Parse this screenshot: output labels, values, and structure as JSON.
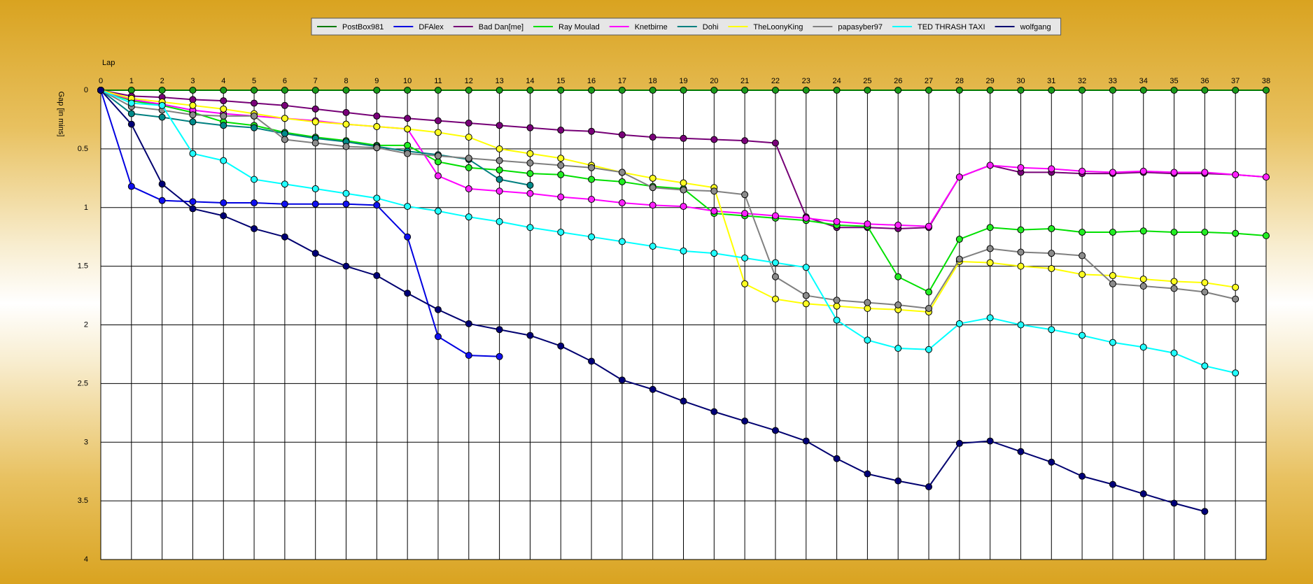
{
  "chart_data": {
    "type": "line",
    "xlabel": "Lap",
    "ylabel": "Gap [in mins]",
    "xlim": [
      0,
      38
    ],
    "ylim": [
      0,
      4
    ],
    "y_inverted": true,
    "x_ticks": [
      0,
      1,
      2,
      3,
      4,
      5,
      6,
      7,
      8,
      9,
      10,
      11,
      12,
      13,
      14,
      15,
      16,
      17,
      18,
      19,
      20,
      21,
      22,
      23,
      24,
      25,
      26,
      27,
      28,
      29,
      30,
      31,
      32,
      33,
      34,
      35,
      36,
      37,
      38
    ],
    "y_ticks": [
      "0",
      "0.5",
      "1",
      "1.5",
      "2",
      "2.5",
      "3",
      "3.5",
      "4"
    ],
    "grid": true,
    "legend_placement": "top-center",
    "series": [
      {
        "name": "PostBox981",
        "color": "#007a00",
        "marker_color": "#1a9a1a",
        "values": [
          0,
          0,
          0,
          0,
          0,
          0,
          0,
          0,
          0,
          0,
          0,
          0,
          0,
          0,
          0,
          0,
          0,
          0,
          0,
          0,
          0,
          0,
          0,
          0,
          0,
          0,
          0,
          0,
          0,
          0,
          0,
          0,
          0,
          0,
          0,
          0,
          0,
          0,
          0
        ]
      },
      {
        "name": "DFAlex",
        "color": "#0000e0",
        "marker_color": "#1010f0",
        "values": [
          0,
          0.82,
          0.94,
          0.95,
          0.96,
          0.96,
          0.97,
          0.97,
          0.97,
          0.98,
          1.25,
          2.1,
          2.26,
          2.27
        ]
      },
      {
        "name": "Bad Dan[me]",
        "color": "#760076",
        "marker_color": "#7a007a",
        "values": [
          0,
          0.05,
          0.06,
          0.08,
          0.09,
          0.11,
          0.13,
          0.16,
          0.19,
          0.22,
          0.24,
          0.26,
          0.28,
          0.3,
          0.32,
          0.34,
          0.35,
          0.38,
          0.4,
          0.41,
          0.42,
          0.43,
          0.45,
          1.08,
          1.17,
          1.17,
          1.18,
          1.17,
          0.74,
          0.64,
          0.7,
          0.7,
          0.71,
          0.71,
          0.7,
          0.71,
          0.71,
          0.72,
          0.74
        ]
      },
      {
        "name": "Ray Moulad",
        "color": "#00e000",
        "marker_color": "#22ee22",
        "values": [
          0,
          0.09,
          0.13,
          0.19,
          0.27,
          0.3,
          0.36,
          0.4,
          0.43,
          0.47,
          0.47,
          0.61,
          0.66,
          0.68,
          0.71,
          0.72,
          0.76,
          0.78,
          0.82,
          0.84,
          1.05,
          1.07,
          1.09,
          1.11,
          1.15,
          1.16,
          1.59,
          1.72,
          1.27,
          1.17,
          1.19,
          1.18,
          1.21,
          1.21,
          1.2,
          1.21,
          1.21,
          1.22,
          1.24
        ]
      },
      {
        "name": "Knetbirne",
        "color": "#ff00ff",
        "marker_color": "#ff22ff",
        "values": [
          0,
          0.08,
          0.12,
          0.17,
          0.2,
          0.22,
          0.24,
          0.26,
          0.29,
          0.31,
          0.33,
          0.73,
          0.84,
          0.86,
          0.88,
          0.91,
          0.93,
          0.96,
          0.98,
          0.99,
          1.03,
          1.05,
          1.07,
          1.09,
          1.12,
          1.14,
          1.15,
          1.16,
          0.74,
          0.64,
          0.66,
          0.67,
          0.69,
          0.7,
          0.69,
          0.7,
          0.7,
          0.72,
          0.74
        ]
      },
      {
        "name": "Dohi",
        "color": "#008080",
        "marker_color": "#008b8b",
        "values": [
          0,
          0.2,
          0.23,
          0.27,
          0.3,
          0.32,
          0.37,
          0.41,
          0.44,
          0.48,
          0.52,
          0.55,
          0.59,
          0.76,
          0.81
        ]
      },
      {
        "name": "TheLoonyKing",
        "color": "#ffff00",
        "marker_color": "#ffff22",
        "values": [
          0,
          0.07,
          0.1,
          0.13,
          0.16,
          0.2,
          0.24,
          0.27,
          0.29,
          0.31,
          0.33,
          0.36,
          0.4,
          0.5,
          0.54,
          0.58,
          0.64,
          0.7,
          0.75,
          0.79,
          0.83,
          1.65,
          1.78,
          1.82,
          1.84,
          1.86,
          1.87,
          1.89,
          1.46,
          1.47,
          1.5,
          1.52,
          1.57,
          1.58,
          1.61,
          1.63,
          1.64,
          1.68
        ]
      },
      {
        "name": "papasyber97",
        "color": "#808080",
        "marker_color": "#8c8c8c",
        "values": [
          0,
          0.14,
          0.17,
          0.21,
          0.22,
          0.22,
          0.42,
          0.45,
          0.48,
          0.49,
          0.54,
          0.56,
          0.58,
          0.6,
          0.62,
          0.64,
          0.66,
          0.7,
          0.83,
          0.85,
          0.86,
          0.89,
          1.59,
          1.75,
          1.79,
          1.81,
          1.83,
          1.86,
          1.44,
          1.35,
          1.38,
          1.39,
          1.41,
          1.65,
          1.67,
          1.69,
          1.72,
          1.78
        ]
      },
      {
        "name": "TED THRASH TAXI",
        "color": "#00ffff",
        "marker_color": "#22ffff",
        "values": [
          0,
          0.11,
          0.13,
          0.54,
          0.6,
          0.76,
          0.8,
          0.84,
          0.88,
          0.92,
          0.99,
          1.03,
          1.08,
          1.12,
          1.17,
          1.21,
          1.25,
          1.29,
          1.33,
          1.37,
          1.39,
          1.43,
          1.47,
          1.51,
          1.96,
          2.13,
          2.2,
          2.21,
          1.99,
          1.94,
          2.0,
          2.04,
          2.09,
          2.15,
          2.19,
          2.24,
          2.35,
          2.41
        ]
      },
      {
        "name": "wolfgang",
        "color": "#000070",
        "marker_color": "#000078",
        "values": [
          0,
          0.29,
          0.8,
          1.01,
          1.07,
          1.18,
          1.25,
          1.39,
          1.5,
          1.58,
          1.73,
          1.87,
          1.99,
          2.04,
          2.09,
          2.18,
          2.31,
          2.47,
          2.55,
          2.65,
          2.74,
          2.82,
          2.9,
          2.99,
          3.14,
          3.27,
          3.33,
          3.38,
          3.01,
          2.99,
          3.08,
          3.17,
          3.29,
          3.36,
          3.44,
          3.52,
          3.59
        ]
      }
    ]
  }
}
